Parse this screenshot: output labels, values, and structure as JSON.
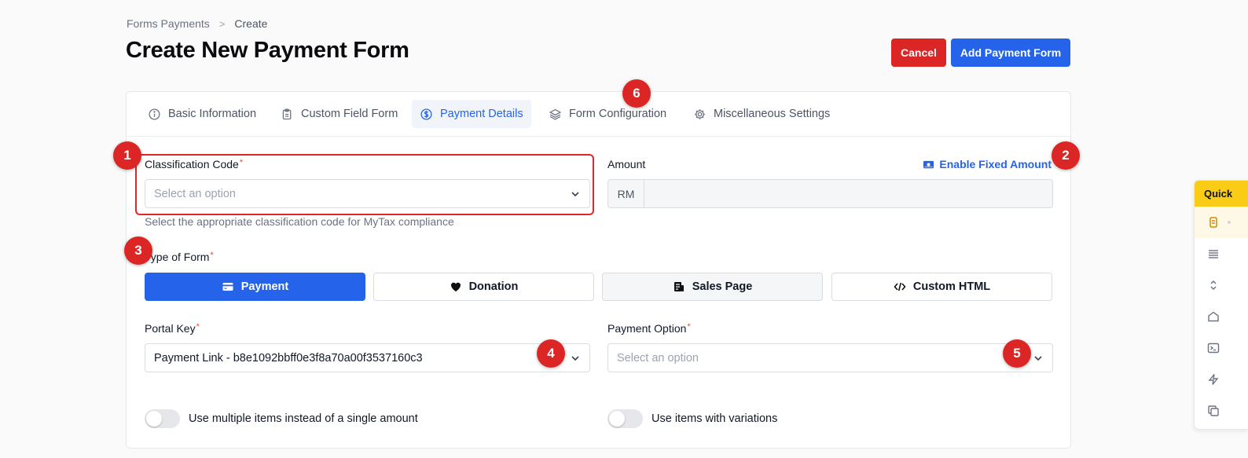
{
  "breadcrumb": {
    "parent": "Forms Payments",
    "separator": ">",
    "current": "Create"
  },
  "page": {
    "title": "Create New Payment Form"
  },
  "header_actions": {
    "cancel_label": "Cancel",
    "add_label": "Add Payment Form"
  },
  "tabs": [
    {
      "label": "Basic Information",
      "icon": "info-icon",
      "active": false
    },
    {
      "label": "Custom Field Form",
      "icon": "clipboard-icon",
      "active": false
    },
    {
      "label": "Payment Details",
      "icon": "dollar-circle-icon",
      "active": true
    },
    {
      "label": "Form Configuration",
      "icon": "layers-icon",
      "active": false
    },
    {
      "label": "Miscellaneous Settings",
      "icon": "gear-icon",
      "active": false
    }
  ],
  "classification": {
    "label": "Classification Code",
    "required_mark": "*",
    "placeholder": "Select an option",
    "help": "Select the appropriate classification code for MyTax compliance"
  },
  "amount": {
    "label": "Amount",
    "prefix": "RM",
    "value": "",
    "enable_fixed_label": "Enable Fixed Amount"
  },
  "form_type": {
    "label": "Type of Form",
    "required_mark": "*",
    "options": [
      {
        "label": "Payment",
        "icon": "credit-card-icon",
        "selected": true
      },
      {
        "label": "Donation",
        "icon": "heart-icon",
        "selected": false
      },
      {
        "label": "Sales Page",
        "icon": "receipt-icon",
        "selected": false
      },
      {
        "label": "Custom HTML",
        "icon": "code-icon",
        "selected": false
      }
    ]
  },
  "portal_key": {
    "label": "Portal Key",
    "required_mark": "*",
    "value": "Payment Link - b8e1092bbff0e3f8a70a00f3537160c3"
  },
  "payment_option": {
    "label": "Payment Option",
    "required_mark": "*",
    "placeholder": "Select an option"
  },
  "toggles": {
    "multiple_items": {
      "label": "Use multiple items instead of a single amount",
      "on": false
    },
    "variations": {
      "label": "Use items with variations",
      "on": false
    }
  },
  "markers": [
    "1",
    "2",
    "3",
    "4",
    "5",
    "6"
  ],
  "quick_panel": {
    "title": "Quick",
    "items": [
      "database-icon",
      "list-icon",
      "chevron-updown-icon",
      "home-icon",
      "terminal-icon",
      "bolt-icon",
      "copy-icon"
    ]
  },
  "colors": {
    "primary": "#2563eb",
    "danger": "#dc2626",
    "quick_header": "#facc15"
  }
}
